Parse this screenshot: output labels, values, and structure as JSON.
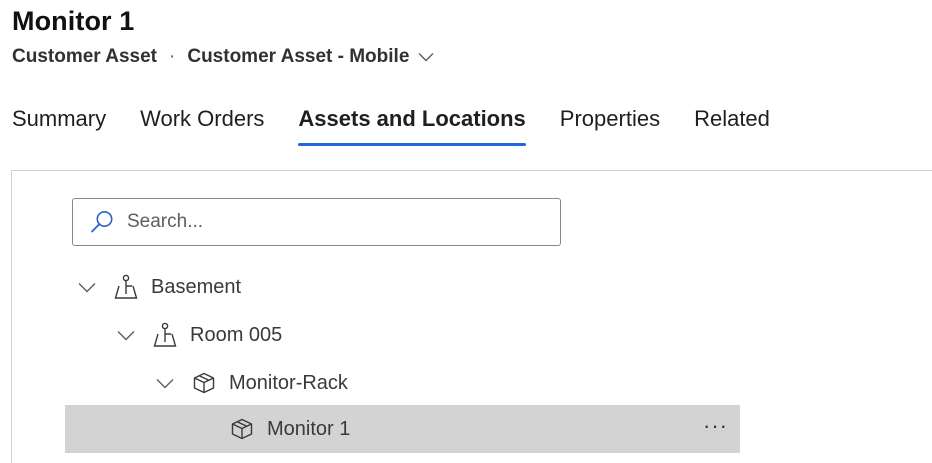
{
  "header": {
    "title": "Monitor 1",
    "entity": "Customer Asset",
    "separator": "·",
    "form_name": "Customer Asset - Mobile"
  },
  "tabs": [
    {
      "label": "Summary",
      "active": false
    },
    {
      "label": "Work Orders",
      "active": false
    },
    {
      "label": "Assets and Locations",
      "active": true
    },
    {
      "label": "Properties",
      "active": false
    },
    {
      "label": "Related",
      "active": false
    }
  ],
  "search": {
    "placeholder": "Search..."
  },
  "tree": [
    {
      "label": "Basement",
      "type": "location",
      "icon": "location-icon",
      "expanded": true
    },
    {
      "label": "Room 005",
      "type": "location",
      "icon": "location-icon",
      "expanded": true
    },
    {
      "label": "Monitor-Rack",
      "type": "asset",
      "icon": "asset-box-icon",
      "expanded": true
    },
    {
      "label": "Monitor 1",
      "type": "asset",
      "icon": "asset-box-icon",
      "selected": true,
      "more": "···"
    }
  ],
  "colors": {
    "accent": "#2266e3",
    "selected_row": "#d3d3d3"
  }
}
